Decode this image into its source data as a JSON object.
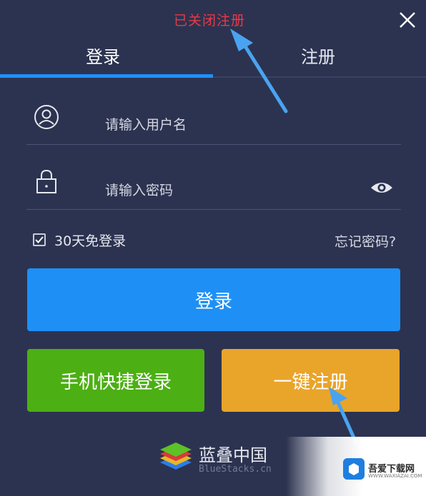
{
  "notice": "已关闭注册",
  "tabs": [
    {
      "label": "登录",
      "active": true
    },
    {
      "label": "注册",
      "active": false
    }
  ],
  "fields": {
    "username_placeholder": "请输入用户名",
    "password_placeholder": "请输入密码"
  },
  "remember": {
    "label": "30天免登录",
    "checked": true
  },
  "forgot_label": "忘记密码?",
  "buttons": {
    "login": "登录",
    "phone_login": "手机快捷登录",
    "quick_register": "一键注册"
  },
  "brand": {
    "name_cn": "蓝叠中国",
    "name_en": "BlueStacks.cn"
  },
  "watermark": {
    "text": "吾爱下载网",
    "sub": "WWW.WAXIAZAI.COM"
  },
  "icons": [
    "close-icon",
    "user-icon",
    "lock-icon",
    "eye-icon",
    "checkbox-icon",
    "bluestacks-logo",
    "arrow-annotation"
  ],
  "colors": {
    "background": "#2c3350",
    "accent": "#1e90f5",
    "green": "#4caf13",
    "orange": "#e9a42a",
    "notice_red": "#e8394a"
  }
}
